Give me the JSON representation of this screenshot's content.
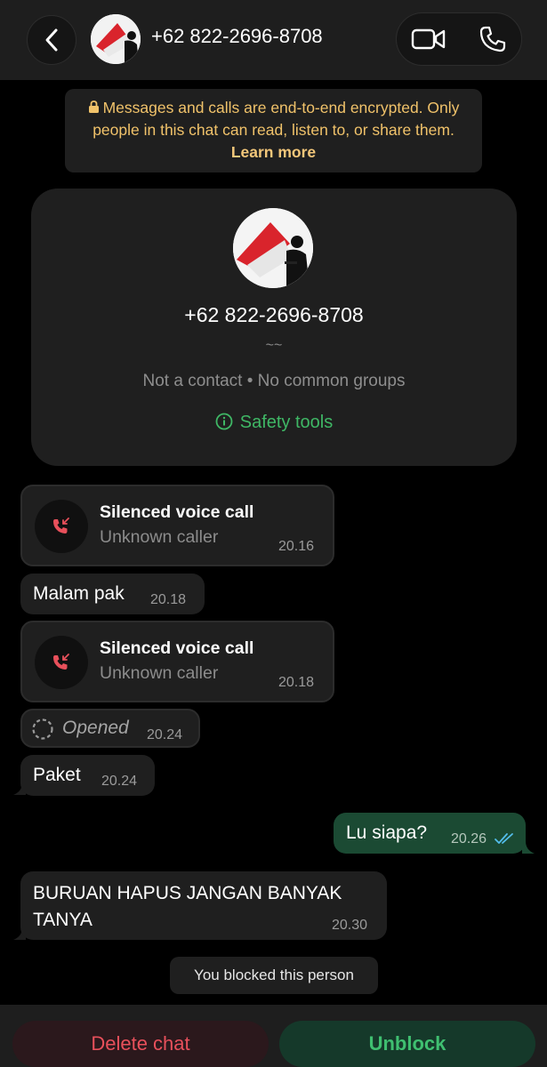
{
  "header": {
    "title": "+62 822-2696-8708",
    "back_icon": "chevron-left-icon",
    "video_icon": "video-camera-icon",
    "phone_icon": "phone-icon"
  },
  "notice": {
    "text": "Messages and calls are end-to-end encrypted. Only people in this chat can read, listen to, or share them.",
    "link": "Learn more",
    "icon": "lock-icon"
  },
  "profile_card": {
    "number": "+62 822-2696-8708",
    "about": "~~",
    "meta": "Not a contact • No common groups",
    "safety_label": "Safety tools",
    "safety_icon": "info-circle-icon"
  },
  "messages": [
    {
      "type": "call",
      "title": "Silenced voice call",
      "subtitle": "Unknown caller",
      "time": "20.16"
    },
    {
      "type": "text",
      "text": "Malam pak",
      "time": "20.18"
    },
    {
      "type": "call",
      "title": "Silenced voice call",
      "subtitle": "Unknown caller",
      "time": "20.18"
    },
    {
      "type": "view-once",
      "text": "Opened",
      "time": "20.24"
    },
    {
      "type": "text",
      "text": "Paket",
      "time": "20.24"
    },
    {
      "type": "outgoing",
      "text": "Lu siapa?",
      "time": "20.26"
    },
    {
      "type": "text",
      "text": "BURUAN HAPUS JANGAN BANYAK TANYA",
      "time": "20.30"
    }
  ],
  "system": {
    "blocked": "You blocked this person"
  },
  "actions": {
    "delete": "Delete chat",
    "unblock": "Unblock"
  },
  "colors": {
    "accent_green": "#3fb765",
    "delete_red": "#e8505b",
    "notice_yellow": "#f0c26a",
    "outgoing_bubble": "#1b4a33",
    "read_ticks": "#53bdeb"
  }
}
